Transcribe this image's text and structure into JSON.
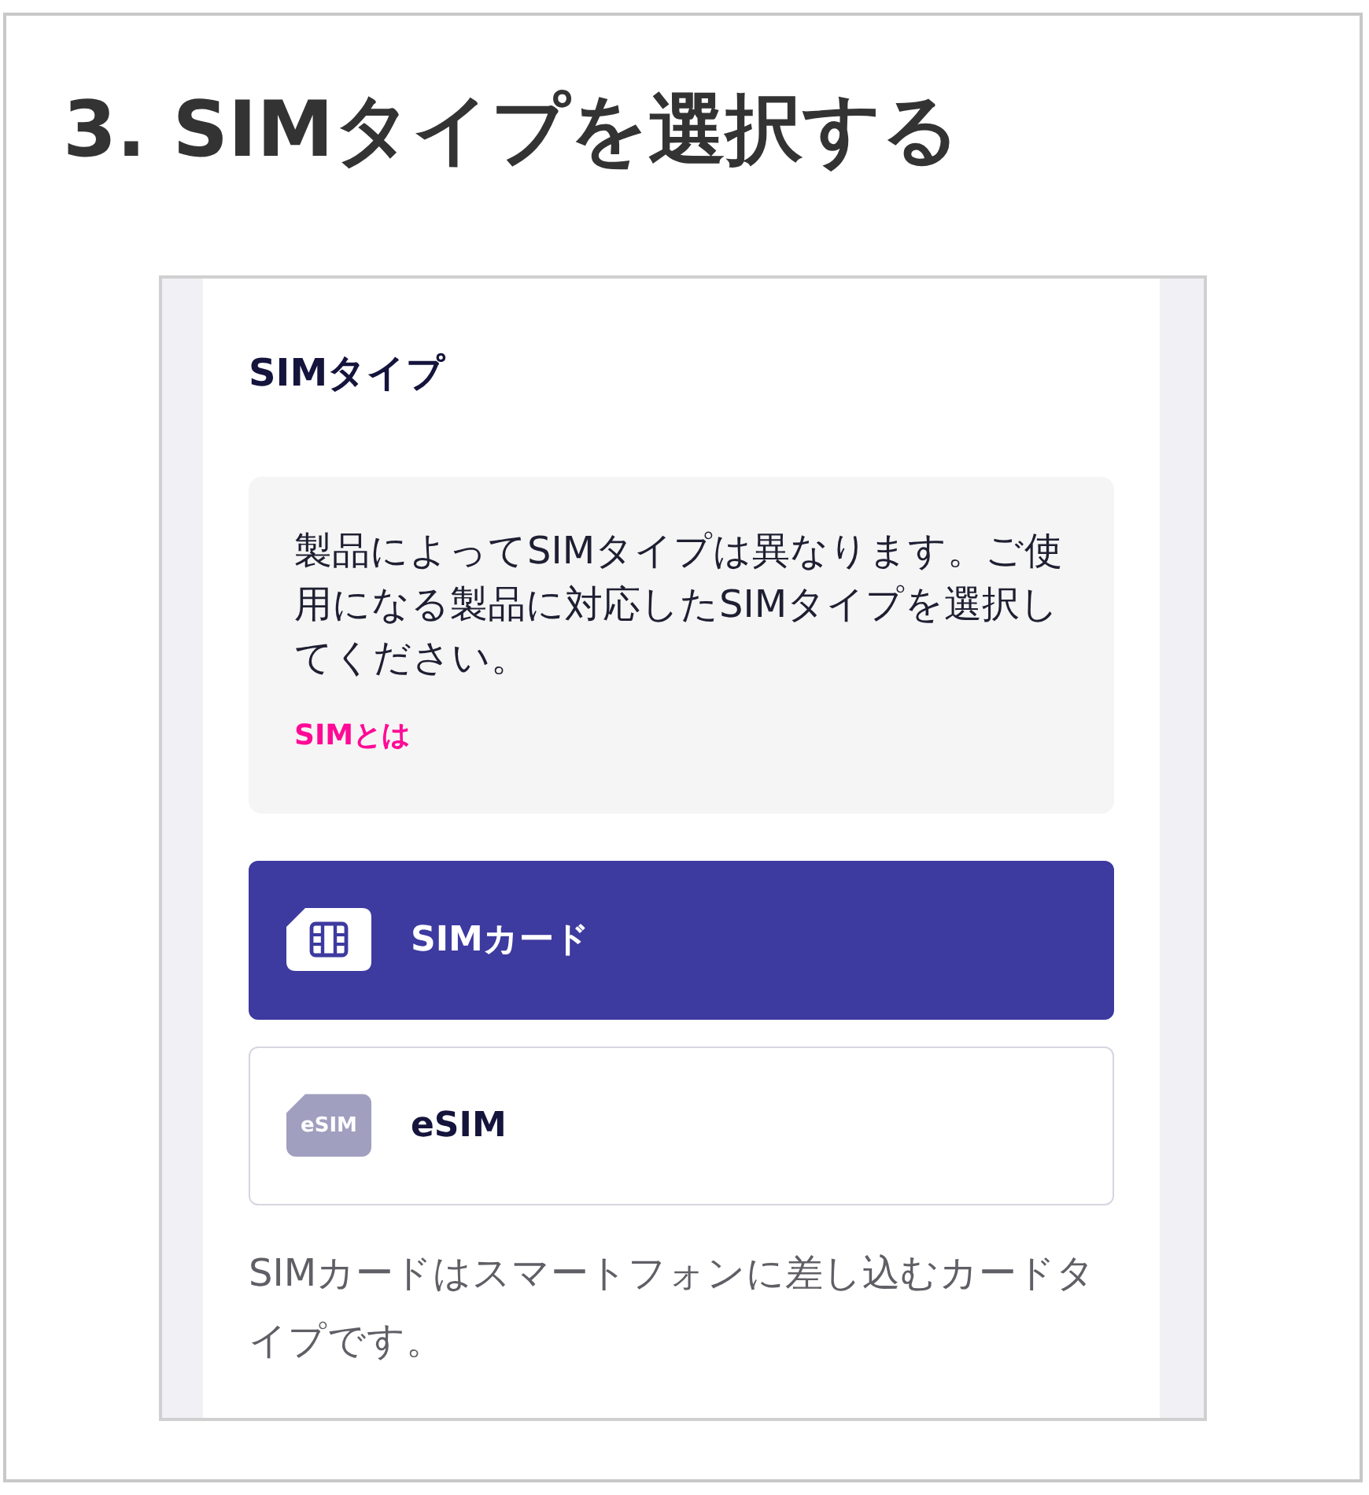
{
  "title": "3. SIMタイプを選択する",
  "panel": {
    "heading": "SIMタイプ",
    "info": {
      "text": "製品によってSIMタイプは異なります。ご使用になる製品に対応したSIMタイプを選択してください。",
      "link": "SIMとは"
    },
    "options": [
      {
        "kind": "sim_card",
        "label": "SIMカード",
        "selected": true
      },
      {
        "kind": "esim",
        "icon_text": "eSIM",
        "label": "eSIM",
        "selected": false
      }
    ],
    "description": "SIMカードはスマートフォンに差し込むカードタイプです。"
  }
}
